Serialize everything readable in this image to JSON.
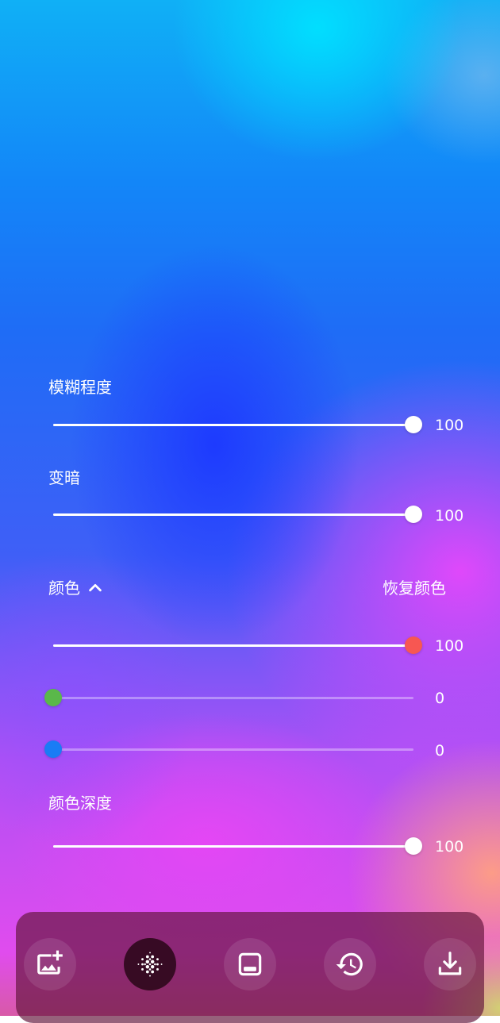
{
  "sliders": {
    "blur": {
      "label": "模糊程度",
      "value": "100",
      "fraction": 1.0,
      "thumb_color": "#ffffff"
    },
    "darken": {
      "label": "变暗",
      "value": "100",
      "fraction": 1.0,
      "thumb_color": "#ffffff"
    },
    "red": {
      "value": "100",
      "fraction": 1.0,
      "thumb_color": "#f75752"
    },
    "green": {
      "value": "0",
      "fraction": 0.0,
      "thumb_color": "#5ab84a"
    },
    "blue": {
      "value": "0",
      "fraction": 0.0,
      "thumb_color": "#1a7cf5"
    },
    "color_depth": {
      "label": "颜色深度",
      "value": "100",
      "fraction": 1.0,
      "thumb_color": "#ffffff"
    }
  },
  "color_section": {
    "label": "颜色",
    "toggle_icon": "chevron-up-icon",
    "restore_label": "恢复颜色"
  },
  "toolbar": {
    "buttons": [
      {
        "icon": "add-image-icon",
        "active": false
      },
      {
        "icon": "blur-dots-icon",
        "active": true
      },
      {
        "icon": "bottom-panel-icon",
        "active": false
      },
      {
        "icon": "history-icon",
        "active": false
      },
      {
        "icon": "download-icon",
        "active": false
      }
    ]
  },
  "colors": {
    "bar_background": "#64163c",
    "active_button": "#28061a",
    "text": "#ffffff"
  }
}
